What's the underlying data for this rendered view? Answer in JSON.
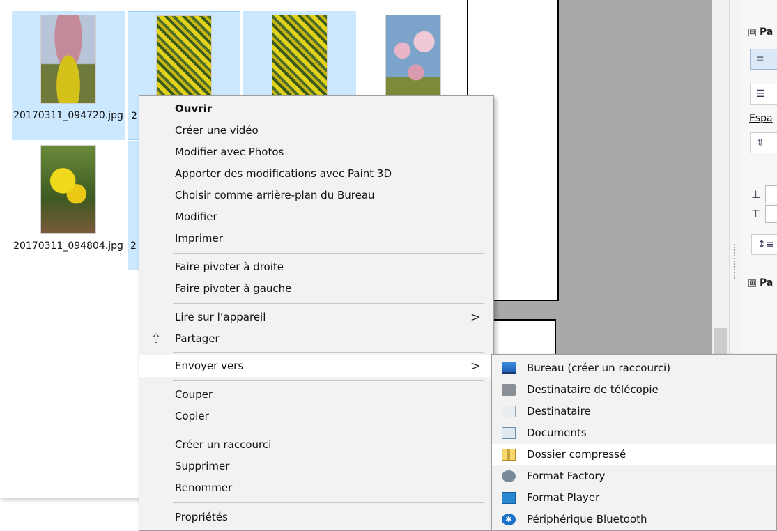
{
  "explorer": {
    "files": [
      {
        "name": "20170311_094720.jpg",
        "selected": true
      },
      {
        "name": "",
        "selected": true,
        "focused": true
      },
      {
        "name": "",
        "selected": true
      },
      {
        "name": "",
        "selected": false
      },
      {
        "name": "20170311_094804.jpg",
        "selected": false
      },
      {
        "name": "",
        "selected": true
      }
    ],
    "truncated_captions": [
      "2",
      "2"
    ]
  },
  "context_menu": {
    "items": [
      {
        "label": "Ouvrir",
        "bold": true
      },
      {
        "label": "Créer une vidéo"
      },
      {
        "label": "Modifier avec Photos"
      },
      {
        "label": "Apporter des modifications avec Paint 3D"
      },
      {
        "label": "Choisir comme arrière-plan du Bureau"
      },
      {
        "label": "Modifier"
      },
      {
        "label": "Imprimer"
      },
      {
        "label": "Faire pivoter à droite"
      },
      {
        "label": "Faire pivoter à gauche"
      },
      {
        "label": "Lire sur l’appareil",
        "submenu_arrow": ">"
      },
      {
        "label": "Partager",
        "icon": "share-icon"
      },
      {
        "label": "Envoyer vers",
        "submenu_arrow": ">",
        "highlighted": true
      },
      {
        "label": "Couper"
      },
      {
        "label": "Copier"
      },
      {
        "label": "Créer un raccourci"
      },
      {
        "label": "Supprimer"
      },
      {
        "label": "Renommer"
      },
      {
        "label": "Propriétés"
      }
    ]
  },
  "send_to_menu": {
    "items": [
      {
        "label": "Bureau (créer un raccourci)",
        "icon": "desktop-icon"
      },
      {
        "label": "Destinataire de télécopie",
        "icon": "fax-icon"
      },
      {
        "label": "Destinataire",
        "icon": "mail-recipient-icon"
      },
      {
        "label": "Documents",
        "icon": "documents-icon"
      },
      {
        "label": "Dossier compressé",
        "icon": "zip-folder-icon",
        "highlighted": true
      },
      {
        "label": "Format Factory",
        "icon": "format-factory-icon"
      },
      {
        "label": "Format Player",
        "icon": "format-player-icon"
      },
      {
        "label": "Périphérique Bluetooth",
        "icon": "bluetooth-icon"
      }
    ]
  },
  "properties_panel": {
    "section1": {
      "label": "Pa",
      "toggle": "⊟"
    },
    "spacing_label": "Espa",
    "section2": {
      "label": "Pa",
      "toggle": "⊞"
    }
  },
  "icons": {
    "share": "⇪",
    "bluetooth": "✱"
  }
}
